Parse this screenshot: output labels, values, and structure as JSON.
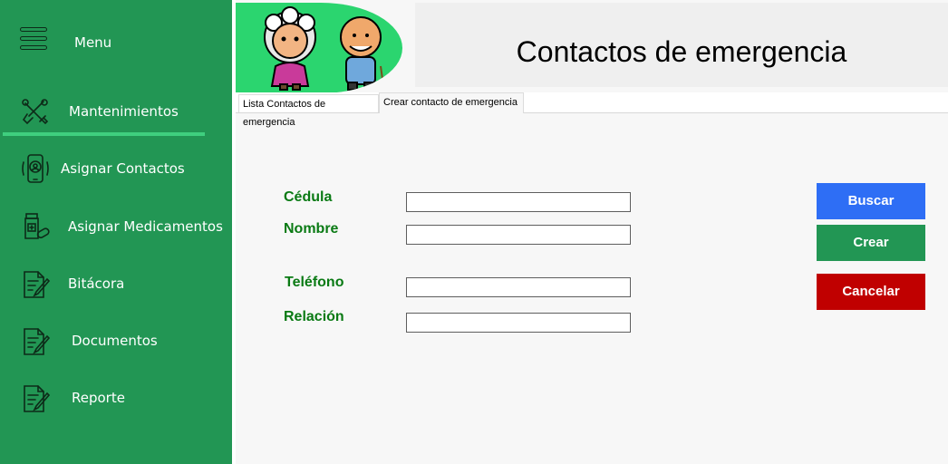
{
  "sidebar": {
    "menu_label": "Menu",
    "items": [
      {
        "label": "Mantenimientos",
        "icon": "tools-icon"
      },
      {
        "label": "Asignar Contactos",
        "icon": "phone-contact-icon"
      },
      {
        "label": "Asignar Medicamentos",
        "icon": "medicine-icon"
      },
      {
        "label": "Bitácora",
        "icon": "document-pen-icon"
      },
      {
        "label": "Documentos",
        "icon": "document-pen-icon"
      },
      {
        "label": "Reporte",
        "icon": "document-pen-icon"
      }
    ]
  },
  "header": {
    "title": "Contactos de emergencia"
  },
  "tabs": [
    {
      "label": "Lista Contactos de emergencia"
    },
    {
      "label": "Crear contacto de emergencia"
    }
  ],
  "form": {
    "fields": [
      {
        "label": "Cédula",
        "value": ""
      },
      {
        "label": "Nombre",
        "value": ""
      },
      {
        "label": "Teléfono",
        "value": ""
      },
      {
        "label": "Relación",
        "value": ""
      }
    ],
    "buttons": {
      "search": "Buscar",
      "create": "Crear",
      "cancel": "Cancelar"
    }
  },
  "colors": {
    "sidebar": "#229654",
    "logo_bg": "#2bd56f",
    "label": "#0a7a14",
    "search_button": "#2e6ef5",
    "create_button": "#229654",
    "cancel_button": "#c00000"
  }
}
